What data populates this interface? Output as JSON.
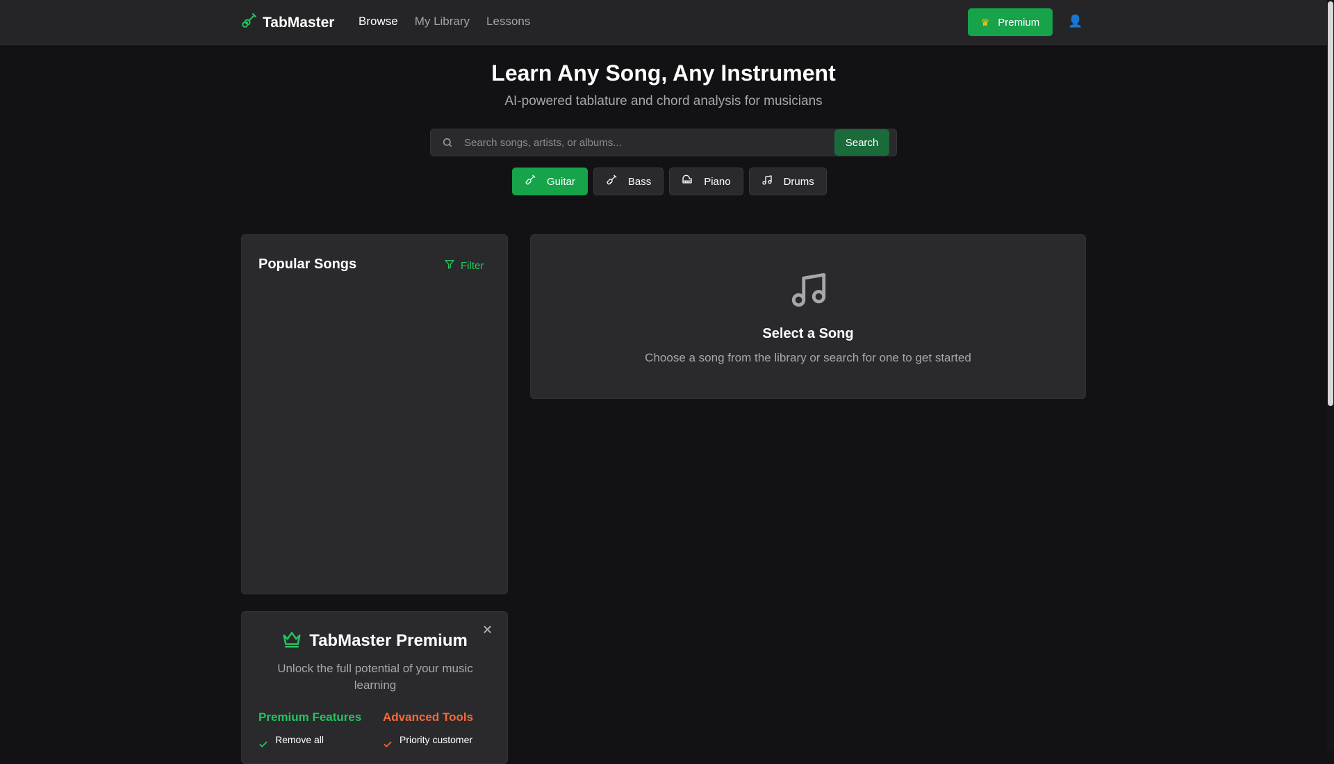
{
  "header": {
    "brand": "TabMaster",
    "nav": [
      "Browse",
      "My Library",
      "Lessons"
    ],
    "premium_label": "Premium",
    "user_icon": "👤"
  },
  "hero": {
    "title": "Learn Any Song, Any Instrument",
    "subtitle": "AI-powered tablature and chord analysis for musicians"
  },
  "search": {
    "placeholder": "Search songs, artists, or albums...",
    "button_label": "Search"
  },
  "instruments": [
    {
      "label": "Guitar",
      "icon": "guitar-icon"
    },
    {
      "label": "Bass",
      "icon": "bass-icon"
    },
    {
      "label": "Piano",
      "icon": "piano-icon"
    },
    {
      "label": "Drums",
      "icon": "drums-icon"
    }
  ],
  "popular": {
    "title": "Popular Songs",
    "filter_label": "Filter"
  },
  "select_song": {
    "title": "Select a Song",
    "subtitle": "Choose a song from the library or search for one to get started"
  },
  "premium_card": {
    "title": "TabMaster Premium",
    "subtitle": "Unlock the full potential of your music learning",
    "features_title": "Premium Features",
    "features": [
      "Remove all"
    ],
    "tools_title": "Advanced Tools",
    "tools": [
      "Priority customer"
    ]
  },
  "colors": {
    "accent": "#16a34a",
    "accent_text": "#22c55e",
    "tools_title": "#f26b3a",
    "background": "#121214",
    "panel": "#2a2a2d"
  }
}
